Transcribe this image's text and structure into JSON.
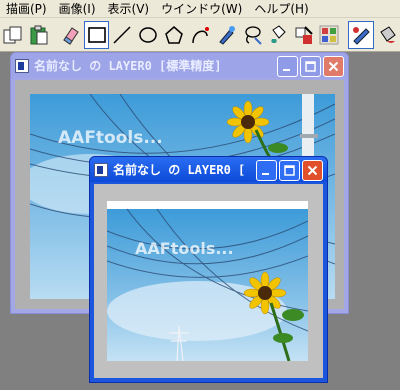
{
  "menu": [
    {
      "label": "描画(P)"
    },
    {
      "label": "画像(I)"
    },
    {
      "label": "表示(V)"
    },
    {
      "label": "ウインドウ(W)"
    },
    {
      "label": "ヘルプ(H)"
    }
  ],
  "toolbar": {
    "tools": [
      {
        "icon": "copy-icon"
      },
      {
        "icon": "paste-icon"
      },
      {
        "icon": "eraser-icon"
      },
      {
        "icon": "rectangle-tool-icon"
      },
      {
        "icon": "line-tool-icon"
      },
      {
        "icon": "ellipse-tool-icon"
      },
      {
        "icon": "polygon-tool-icon"
      },
      {
        "icon": "curve-tool-icon"
      },
      {
        "icon": "brush-tool-icon"
      },
      {
        "icon": "lasso-tool-icon"
      },
      {
        "icon": "fill-tool-icon"
      },
      {
        "icon": "color-picker-icon"
      },
      {
        "icon": "pen-tool-icon"
      },
      {
        "icon": "stamp-tool-icon"
      },
      {
        "icon": "fill-bucket-icon"
      }
    ]
  },
  "windows": {
    "back": {
      "title": "名前なし の LAYER0 [標準精度]",
      "watermark": "AAFtools..."
    },
    "front": {
      "title": "名前なし の LAYER0 [",
      "watermark": "AAFtools..."
    }
  }
}
